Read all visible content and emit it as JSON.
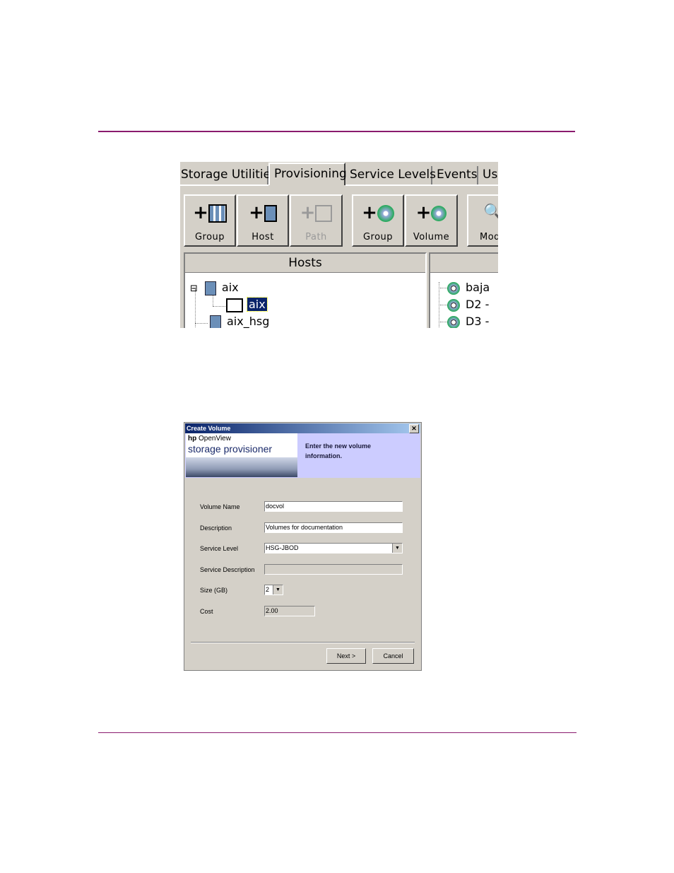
{
  "tabs": [
    "Storage Utilities",
    "Provisioning",
    "Service Levels",
    "Events",
    "Us"
  ],
  "toolbar": [
    {
      "label": "Group",
      "icon": "add-host-group-icon",
      "enabled": true
    },
    {
      "label": "Host",
      "icon": "add-host-icon",
      "enabled": true
    },
    {
      "label": "Path",
      "icon": "add-path-icon",
      "enabled": false
    },
    {
      "label": "Group",
      "icon": "add-volume-group-icon",
      "enabled": true
    },
    {
      "label": "Volume",
      "icon": "add-volume-icon",
      "enabled": true
    },
    {
      "label": "Mod",
      "icon": "modify-icon",
      "enabled": true
    }
  ],
  "hosts_pane": {
    "header": "Hosts",
    "nodes": [
      {
        "label": "aix",
        "expander": "⊟"
      },
      {
        "label": "aix",
        "selected": true
      },
      {
        "label": "aix_hsg"
      }
    ]
  },
  "volumes_pane": {
    "nodes": [
      "baja",
      "D2 -",
      "D3 -"
    ]
  },
  "dialog": {
    "title": "Create Volume",
    "close_glyph": "✕",
    "brand_small_bold": "hp",
    "brand_small": "OpenView",
    "brand_large": "storage provisioner",
    "instruction": "Enter the new volume information.",
    "fields": {
      "volume_name": {
        "label": "Volume Name",
        "value": "docvol"
      },
      "description": {
        "label": "Description",
        "value": "Volumes for documentation"
      },
      "service_level": {
        "label": "Service Level",
        "value": "HSG-JBOD"
      },
      "service_description": {
        "label": "Service Description",
        "value": ""
      },
      "size": {
        "label": "Size (GB)",
        "value": "2"
      },
      "cost": {
        "label": "Cost",
        "value": "2.00"
      }
    },
    "next_label": "Next >",
    "cancel_label": "Cancel"
  },
  "colors": {
    "rule": "#8a1a6e",
    "title_bar": "#0a246a",
    "banner": "#ccccff"
  }
}
